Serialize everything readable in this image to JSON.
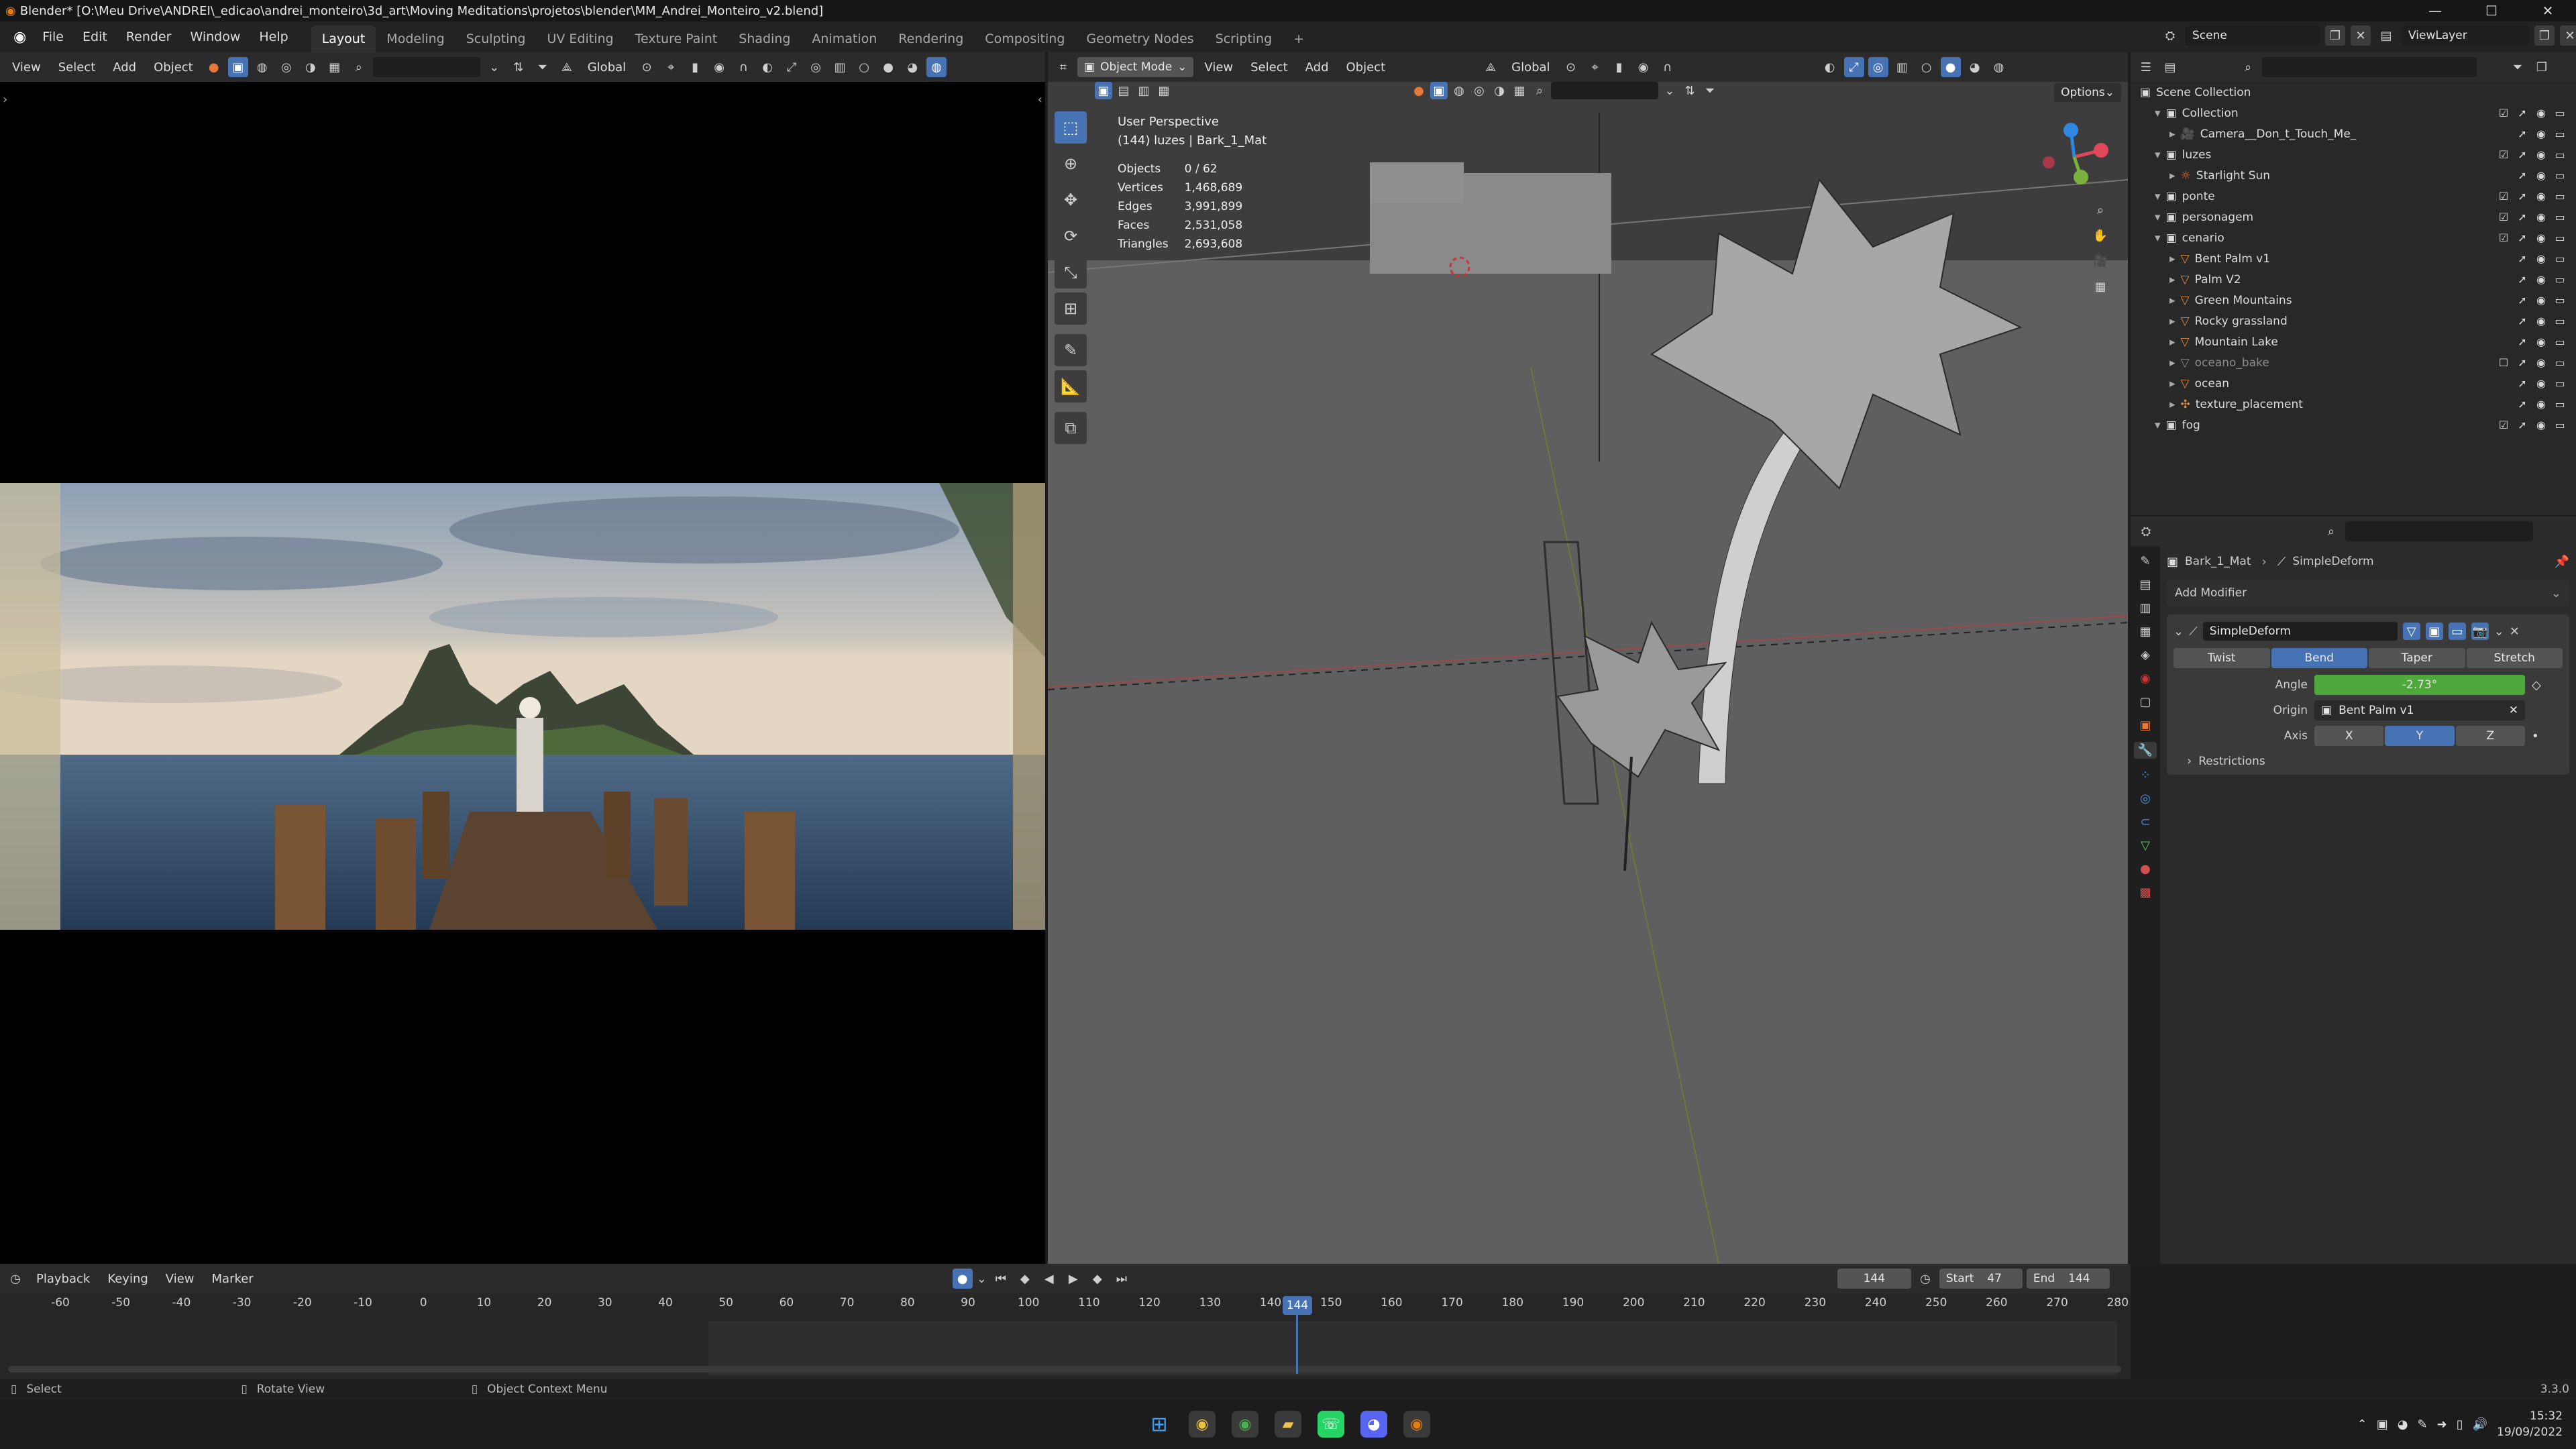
{
  "titlebar": {
    "title": "Blender* [O:\\Meu Drive\\ANDREI\\_edicao\\andrei_monteiro\\3d_art\\Moving Meditations\\projetos\\blender\\MM_Andrei_Monteiro_v2.blend]",
    "min": "—",
    "max": "☐",
    "close": "✕"
  },
  "menu": {
    "items": [
      "File",
      "Edit",
      "Render",
      "Window",
      "Help"
    ]
  },
  "workspaces": [
    "Layout",
    "Modeling",
    "Sculpting",
    "UV Editing",
    "Texture Paint",
    "Shading",
    "Animation",
    "Rendering",
    "Compositing",
    "Geometry Nodes",
    "Scripting",
    "+"
  ],
  "scene": {
    "name": "Scene",
    "viewlayer": "ViewLayer"
  },
  "left_header": {
    "view": "View",
    "select": "Select",
    "add": "Add",
    "object": "Object",
    "orientation": "Global"
  },
  "viewport": {
    "mode": "Object Mode",
    "view": "View",
    "select": "Select",
    "add": "Add",
    "object": "Object",
    "orientation": "Global",
    "options": "Options",
    "perspective": "User Perspective",
    "context": "(144) luzes | Bark_1_Mat",
    "stats": [
      {
        "k": "Objects",
        "v": "0 / 62"
      },
      {
        "k": "Vertices",
        "v": "1,468,689"
      },
      {
        "k": "Edges",
        "v": "3,991,899"
      },
      {
        "k": "Faces",
        "v": "2,531,058"
      },
      {
        "k": "Triangles",
        "v": "2,693,608"
      }
    ]
  },
  "outliner": {
    "root": "Scene Collection",
    "rows": [
      {
        "label": "Collection",
        "indent": 1,
        "kind": "collection"
      },
      {
        "label": "Camera__Don_t_Touch_Me_",
        "indent": 2,
        "kind": "camera"
      },
      {
        "label": "luzes",
        "indent": 1,
        "kind": "collection"
      },
      {
        "label": "Starlight Sun",
        "indent": 2,
        "kind": "light"
      },
      {
        "label": "ponte",
        "indent": 1,
        "kind": "collection"
      },
      {
        "label": "personagem",
        "indent": 1,
        "kind": "collection"
      },
      {
        "label": "cenario",
        "indent": 1,
        "kind": "collection"
      },
      {
        "label": "Bent Palm v1",
        "indent": 2,
        "kind": "mesh"
      },
      {
        "label": "Palm V2",
        "indent": 2,
        "kind": "mesh"
      },
      {
        "label": "Green Mountains",
        "indent": 2,
        "kind": "mesh"
      },
      {
        "label": "Rocky grassland",
        "indent": 2,
        "kind": "mesh"
      },
      {
        "label": "Mountain Lake",
        "indent": 2,
        "kind": "mesh"
      },
      {
        "label": "oceano_bake",
        "indent": 2,
        "kind": "disabled"
      },
      {
        "label": "ocean",
        "indent": 2,
        "kind": "mesh"
      },
      {
        "label": "texture_placement",
        "indent": 2,
        "kind": "empty"
      },
      {
        "label": "fog",
        "indent": 1,
        "kind": "collection"
      }
    ]
  },
  "properties": {
    "breadcrumb_obj": "Bark_1_Mat",
    "breadcrumb_mod": "SimpleDeform",
    "add_modifier": "Add Modifier",
    "modifier_name": "SimpleDeform",
    "modes": [
      "Twist",
      "Bend",
      "Taper",
      "Stretch"
    ],
    "active_mode": "Bend",
    "angle_label": "Angle",
    "angle_value": "-2.73°",
    "origin_label": "Origin",
    "origin_value": "Bent Palm v1",
    "axis_label": "Axis",
    "axes": [
      "X",
      "Y",
      "Z"
    ],
    "active_axis": "Y",
    "restrictions": "Restrictions"
  },
  "timeline": {
    "playback": "Playback",
    "keying": "Keying",
    "view": "View",
    "marker": "Marker",
    "current_frame": "144",
    "start_label": "Start",
    "start": "47",
    "end_label": "End",
    "end": "144",
    "ticks": [
      "-60",
      "-50",
      "-40",
      "-30",
      "-20",
      "-10",
      "0",
      "10",
      "20",
      "30",
      "40",
      "50",
      "60",
      "70",
      "80",
      "90",
      "100",
      "110",
      "120",
      "130",
      "140",
      "150",
      "160",
      "170",
      "180",
      "190",
      "200",
      "210",
      "220",
      "230",
      "240",
      "250",
      "260",
      "270",
      "280"
    ]
  },
  "statusbar": {
    "select": "Select",
    "rotate": "Rotate View",
    "context": "Object Context Menu",
    "version": "3.3.0"
  },
  "taskbar": {
    "time": "15:32",
    "date": "19/09/2022"
  }
}
